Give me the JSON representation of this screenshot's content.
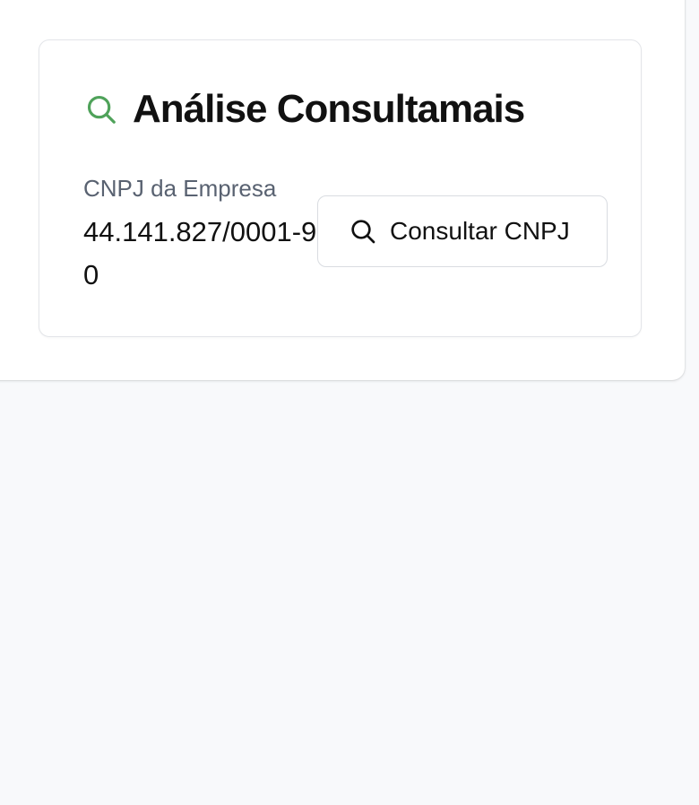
{
  "colors": {
    "accent_green": "#4fa25a",
    "danger_red": "#e0554f",
    "page_background": "#f8f9fb",
    "text_primary": "#111111",
    "text_muted": "#596271"
  },
  "top_buttons": [
    {
      "label": "",
      "color": "#4fa25a"
    },
    {
      "label": "",
      "color": "#e0554f"
    }
  ],
  "card": {
    "icon": "search-icon",
    "title": "Análise Consultamais",
    "field": {
      "label": "CNPJ da Empresa",
      "value": "44.141.827/0001-90"
    },
    "action": {
      "icon": "search-icon",
      "label": "Consultar CNPJ"
    }
  }
}
